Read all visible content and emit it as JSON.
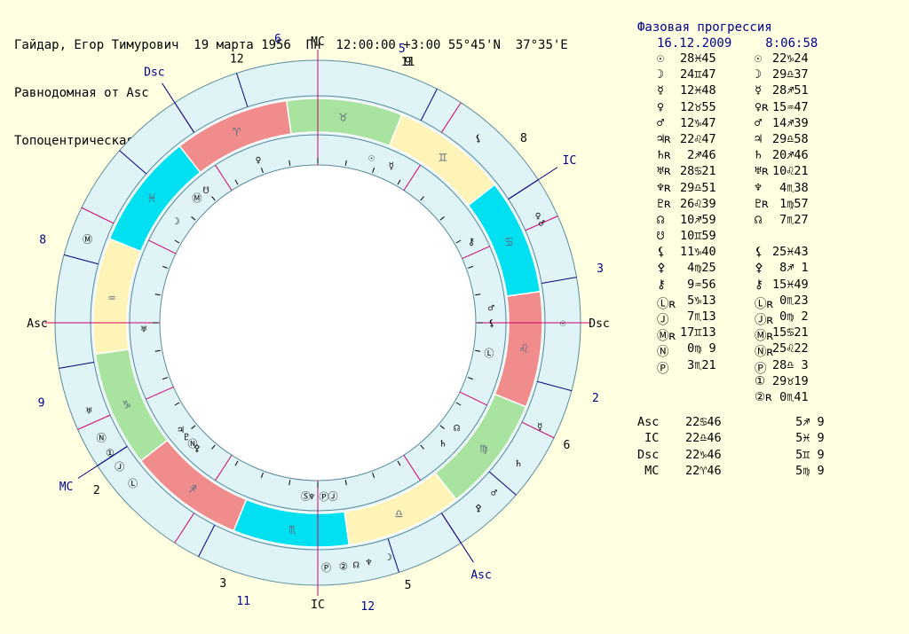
{
  "header": {
    "line1": "Гайдар, Егор Тимурович  19 марта 1956  Пн  12:00:00 +3:00 55°45'N  37°35'E",
    "line2": "Равнодомная от Asc",
    "line3": "Топоцентрическая"
  },
  "table": {
    "title": "Фазовая прогрессия",
    "date": "16.12.2009",
    "time": "8:06:58",
    "rows": [
      {
        "g1": "☉",
        "v1": "28♓45",
        "g2": "☉",
        "v2": "22♑24"
      },
      {
        "g1": "☽",
        "v1": "24♊47",
        "g2": "☽",
        "v2": "29♎37"
      },
      {
        "g1": "☿",
        "v1": "12♓48",
        "g2": "☿",
        "v2": "28♐51"
      },
      {
        "g1": "♀",
        "v1": "12♉55",
        "g2": "♀ʀ",
        "v2": "15♒47"
      },
      {
        "g1": "♂",
        "v1": "12♑47",
        "g2": "♂",
        "v2": "14♐39"
      },
      {
        "g1": "♃ʀ",
        "v1": "22♌47",
        "g2": "♃",
        "v2": "29♎58"
      },
      {
        "g1": "♄ʀ",
        "v1": " 2♐46",
        "g2": "♄",
        "v2": "20♐46"
      },
      {
        "g1": "♅ʀ",
        "v1": "28♋21",
        "g2": "♅ʀ",
        "v2": "10♌21"
      },
      {
        "g1": "♆ʀ",
        "v1": "29♎51",
        "g2": "♆",
        "v2": " 4♏38"
      },
      {
        "g1": "♇ʀ",
        "v1": "26♌39",
        "g2": "♇ʀ",
        "v2": " 1♍57"
      },
      {
        "g1": "☊",
        "v1": "10♐59",
        "g2": "☊",
        "v2": " 7♏27"
      },
      {
        "g1": "☋",
        "v1": "10♊59",
        "g2": "",
        "v2": ""
      },
      {
        "g1": "⚸",
        "v1": "11♑40",
        "g2": "⚸",
        "v2": "25♓43"
      },
      {
        "g1": "⚴",
        "v1": " 4♍25",
        "g2": "⚴",
        "v2": " 8♐ 1"
      },
      {
        "g1": "⚷",
        "v1": " 9♒56",
        "g2": "⚷",
        "v2": "15♓49"
      },
      {
        "g1": "Ⓛʀ",
        "v1": " 5♑13",
        "g2": "Ⓛʀ",
        "v2": " 0♏23"
      },
      {
        "g1": "Ⓙ",
        "v1": " 7♏13",
        "g2": "Ⓙʀ",
        "v2": " 0♍ 2"
      },
      {
        "g1": "Ⓜʀ",
        "v1": "17♊13",
        "g2": "Ⓜʀ",
        "v2": "15♋21"
      },
      {
        "g1": "Ⓝ",
        "v1": " 0♍ 9",
        "g2": "Ⓝʀ",
        "v2": "25♌22"
      },
      {
        "g1": "Ⓟ",
        "v1": " 3♏21",
        "g2": "Ⓟ",
        "v2": "28♎ 3"
      },
      {
        "g1": "",
        "v1": "",
        "g2": "①",
        "v2": "29♉19"
      },
      {
        "g1": "",
        "v1": "",
        "g2": "②ʀ",
        "v2": " 0♏41"
      }
    ],
    "angles": [
      {
        "label": "Asc",
        "v1": "22♋46",
        "v2": " 5♐ 9"
      },
      {
        "label": " IC",
        "v1": "22♎46",
        "v2": " 5♓ 9"
      },
      {
        "label": "Dsc",
        "v1": "22♑46",
        "v2": " 5♊ 9"
      },
      {
        "label": " MC",
        "v1": "22♈46",
        "v2": " 5♍ 9"
      }
    ]
  },
  "wheel": {
    "colors": {
      "fire": "#f08c8c",
      "earth": "#a8e4a0",
      "air": "#fff4b8",
      "water": "#00e0f0",
      "band": "#e0f4f8",
      "cusp_red": "#d0006c",
      "cusp_blue": "#00007b",
      "label": "#00008b"
    },
    "zodiac_glyphs": [
      "♈",
      "♉",
      "♊",
      "♋",
      "♌",
      "♍",
      "♎",
      "♏",
      "♐",
      "♑",
      "♒",
      "♓"
    ],
    "zodiac_elements": [
      "fire",
      "earth",
      "air",
      "water",
      "fire",
      "earth",
      "air",
      "water",
      "fire",
      "earth",
      "air",
      "water"
    ],
    "angle_labels": {
      "mc": "MC",
      "asc": "Asc",
      "dsc": "Dsc",
      "ic": "IC"
    },
    "outer_angle_labels": [
      {
        "text": "Dsc",
        "deg": 123
      },
      {
        "text": "IC",
        "deg": 33
      },
      {
        "text": "Asc",
        "deg": 303
      },
      {
        "text": "MC",
        "deg": 213
      }
    ],
    "inner_house_numbers": [
      {
        "text": "11",
        "deg": 71
      },
      {
        "text": "12",
        "deg": 107
      },
      {
        "text": "2",
        "deg": 217
      },
      {
        "text": "3",
        "deg": 250
      },
      {
        "text": "5",
        "deg": 289
      },
      {
        "text": "6",
        "deg": 334
      },
      {
        "text": "8",
        "deg": 42
      },
      {
        "text": "9",
        "deg": 71
      }
    ],
    "outer_house_numbers": [
      {
        "text": "6",
        "deg": 98
      },
      {
        "text": "5",
        "deg": 73
      },
      {
        "text": "8",
        "deg": 163
      },
      {
        "text": "9",
        "deg": 196
      },
      {
        "text": "11",
        "deg": 255
      },
      {
        "text": "12",
        "deg": 280
      },
      {
        "text": "2",
        "deg": 345
      },
      {
        "text": "3",
        "deg": 11
      }
    ],
    "planets_inner": [
      {
        "g": "☉",
        "deg": 72
      },
      {
        "g": "☿",
        "deg": 65
      },
      {
        "g": "♀",
        "deg": 110
      },
      {
        "g": "☋",
        "deg": 130
      },
      {
        "g": "Ⓜ",
        "deg": 134
      },
      {
        "g": "☽",
        "deg": 144
      },
      {
        "g": "♅",
        "deg": 182
      },
      {
        "g": "♃",
        "deg": 218
      },
      {
        "g": "♇",
        "deg": 221
      },
      {
        "g": "Ⓝ",
        "deg": 224
      },
      {
        "g": "⚴",
        "deg": 226
      },
      {
        "g": "Ⓢ",
        "deg": 266
      },
      {
        "g": "♆",
        "deg": 268
      },
      {
        "g": "Ⓟ",
        "deg": 272
      },
      {
        "g": "Ⓙ",
        "deg": 275
      },
      {
        "g": "♄",
        "deg": 316
      },
      {
        "g": "☊",
        "deg": 323
      },
      {
        "g": "Ⓛ",
        "deg": 350
      },
      {
        "g": "♂",
        "deg": 5
      },
      {
        "g": "⚸",
        "deg": 0
      },
      {
        "g": "⚷",
        "deg": 28
      }
    ],
    "planets_outer": [
      {
        "g": "⚸",
        "deg": 49
      },
      {
        "g": "♀",
        "deg": 26
      },
      {
        "g": "♂",
        "deg": 24
      },
      {
        "g": "☉",
        "deg": 0
      },
      {
        "g": "☿",
        "deg": 335
      },
      {
        "g": "♄",
        "deg": 325
      },
      {
        "g": "♂",
        "deg": 316
      },
      {
        "g": "⚴",
        "deg": 311
      },
      {
        "g": "☽",
        "deg": 287
      },
      {
        "g": "♆",
        "deg": 282
      },
      {
        "g": "☊",
        "deg": 279
      },
      {
        "g": "Ⓟ",
        "deg": 272
      },
      {
        "g": "②",
        "deg": 276
      },
      {
        "g": "Ⓝ",
        "deg": 208
      },
      {
        "g": "Ⓛ",
        "deg": 221
      },
      {
        "g": "Ⓙ",
        "deg": 216
      },
      {
        "g": "①",
        "deg": 212
      },
      {
        "g": "Ⓜ",
        "deg": 160
      },
      {
        "g": "♅",
        "deg": 201
      }
    ]
  }
}
